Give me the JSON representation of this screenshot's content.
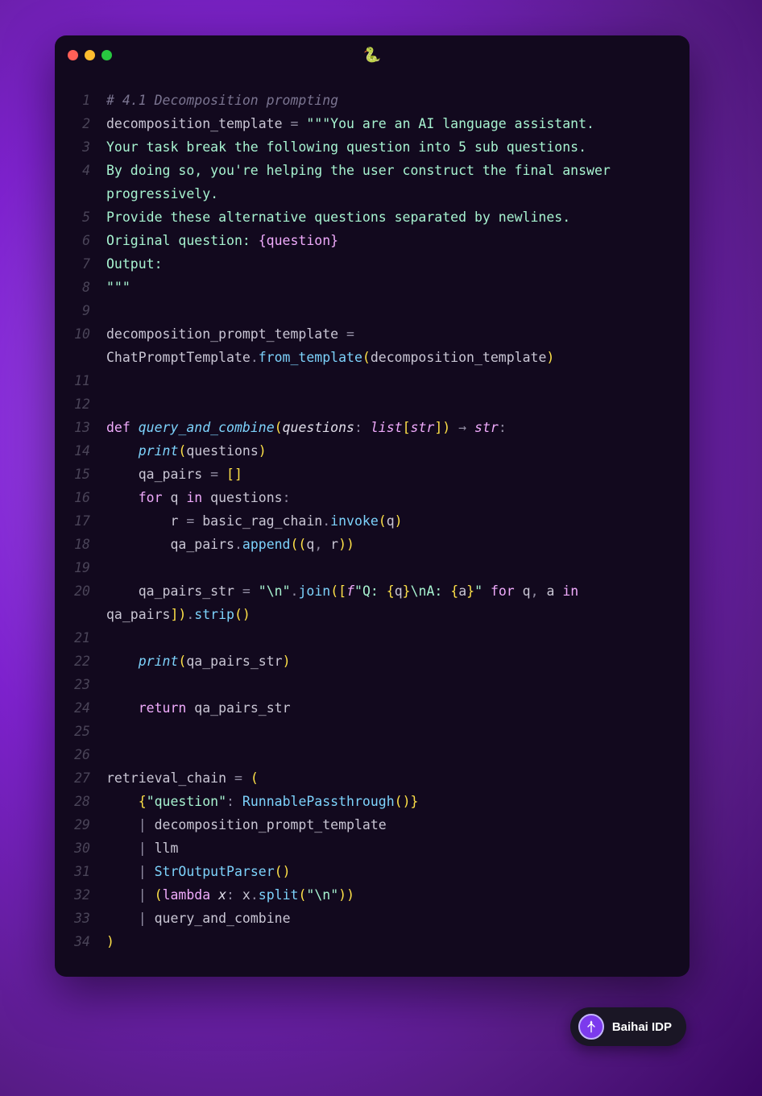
{
  "lang_icon": "🐍",
  "badge": {
    "text": "Baihai IDP"
  },
  "code": {
    "lines": [
      {
        "n": 1,
        "segs": [
          {
            "t": "# 4.1 Decomposition prompting",
            "c": "c-comment"
          }
        ]
      },
      {
        "n": 2,
        "segs": [
          {
            "t": "decomposition_template ",
            "c": "c-default"
          },
          {
            "t": "=",
            "c": "c-op"
          },
          {
            "t": " ",
            "c": "c-default"
          },
          {
            "t": "\"\"\"You are an AI language assistant.",
            "c": "c-str"
          }
        ]
      },
      {
        "n": 3,
        "segs": [
          {
            "t": "Your task break the following question into 5 sub questions.",
            "c": "c-str"
          }
        ]
      },
      {
        "n": 4,
        "segs": [
          {
            "t": "By doing so, you're helping the user construct the final answer ",
            "c": "c-str"
          }
        ]
      },
      {
        "n": "",
        "segs": [
          {
            "t": "progressively.",
            "c": "c-str"
          }
        ]
      },
      {
        "n": 5,
        "segs": [
          {
            "t": "Provide these alternative questions separated by newlines.",
            "c": "c-str"
          }
        ]
      },
      {
        "n": 6,
        "segs": [
          {
            "t": "Original question: ",
            "c": "c-str"
          },
          {
            "t": "{question}",
            "c": "c-placeholder"
          }
        ]
      },
      {
        "n": 7,
        "segs": [
          {
            "t": "Output:",
            "c": "c-str"
          }
        ]
      },
      {
        "n": 8,
        "segs": [
          {
            "t": "\"\"\"",
            "c": "c-str"
          }
        ]
      },
      {
        "n": 9,
        "segs": [
          {
            "t": "",
            "c": "c-default"
          }
        ]
      },
      {
        "n": 10,
        "segs": [
          {
            "t": "decomposition_prompt_template ",
            "c": "c-default"
          },
          {
            "t": "=",
            "c": "c-op"
          },
          {
            "t": " ",
            "c": "c-default"
          }
        ]
      },
      {
        "n": "",
        "segs": [
          {
            "t": "ChatPromptTemplate",
            "c": "c-default"
          },
          {
            "t": ".",
            "c": "c-op"
          },
          {
            "t": "from_template",
            "c": "c-fn"
          },
          {
            "t": "(",
            "c": "c-brace"
          },
          {
            "t": "decomposition_template",
            "c": "c-default"
          },
          {
            "t": ")",
            "c": "c-brace"
          }
        ]
      },
      {
        "n": 11,
        "segs": [
          {
            "t": "",
            "c": "c-default"
          }
        ]
      },
      {
        "n": 12,
        "segs": [
          {
            "t": "",
            "c": "c-default"
          }
        ]
      },
      {
        "n": 13,
        "segs": [
          {
            "t": "def ",
            "c": "c-kw"
          },
          {
            "t": "query_and_combine",
            "c": "c-fn-i"
          },
          {
            "t": "(",
            "c": "c-brace"
          },
          {
            "t": "questions",
            "c": "c-param"
          },
          {
            "t": ":",
            "c": "c-op"
          },
          {
            "t": " list",
            "c": "c-type"
          },
          {
            "t": "[",
            "c": "c-brace"
          },
          {
            "t": "str",
            "c": "c-type"
          },
          {
            "t": "]",
            "c": "c-brace"
          },
          {
            "t": ")",
            "c": "c-brace"
          },
          {
            "t": " → ",
            "c": "c-op"
          },
          {
            "t": "str",
            "c": "c-type"
          },
          {
            "t": ":",
            "c": "c-op"
          }
        ]
      },
      {
        "n": 14,
        "segs": [
          {
            "t": "    ",
            "c": "c-default"
          },
          {
            "t": "print",
            "c": "c-fn-i"
          },
          {
            "t": "(",
            "c": "c-brace"
          },
          {
            "t": "questions",
            "c": "c-default"
          },
          {
            "t": ")",
            "c": "c-brace"
          }
        ]
      },
      {
        "n": 15,
        "segs": [
          {
            "t": "    qa_pairs ",
            "c": "c-default"
          },
          {
            "t": "=",
            "c": "c-op"
          },
          {
            "t": " ",
            "c": "c-default"
          },
          {
            "t": "[]",
            "c": "c-brace"
          }
        ]
      },
      {
        "n": 16,
        "segs": [
          {
            "t": "    ",
            "c": "c-default"
          },
          {
            "t": "for",
            "c": "c-kw"
          },
          {
            "t": " q ",
            "c": "c-default"
          },
          {
            "t": "in",
            "c": "c-kw"
          },
          {
            "t": " questions",
            "c": "c-default"
          },
          {
            "t": ":",
            "c": "c-op"
          }
        ]
      },
      {
        "n": 17,
        "segs": [
          {
            "t": "        r ",
            "c": "c-default"
          },
          {
            "t": "=",
            "c": "c-op"
          },
          {
            "t": " basic_rag_chain",
            "c": "c-default"
          },
          {
            "t": ".",
            "c": "c-op"
          },
          {
            "t": "invoke",
            "c": "c-fn"
          },
          {
            "t": "(",
            "c": "c-brace"
          },
          {
            "t": "q",
            "c": "c-default"
          },
          {
            "t": ")",
            "c": "c-brace"
          }
        ]
      },
      {
        "n": 18,
        "segs": [
          {
            "t": "        qa_pairs",
            "c": "c-default"
          },
          {
            "t": ".",
            "c": "c-op"
          },
          {
            "t": "append",
            "c": "c-fn"
          },
          {
            "t": "((",
            "c": "c-brace"
          },
          {
            "t": "q",
            "c": "c-default"
          },
          {
            "t": ",",
            "c": "c-op"
          },
          {
            "t": " r",
            "c": "c-default"
          },
          {
            "t": "))",
            "c": "c-brace"
          }
        ]
      },
      {
        "n": 19,
        "segs": [
          {
            "t": "",
            "c": "c-default"
          }
        ]
      },
      {
        "n": 20,
        "segs": [
          {
            "t": "    qa_pairs_str ",
            "c": "c-default"
          },
          {
            "t": "=",
            "c": "c-op"
          },
          {
            "t": " ",
            "c": "c-default"
          },
          {
            "t": "\"\\n\"",
            "c": "c-str"
          },
          {
            "t": ".",
            "c": "c-op"
          },
          {
            "t": "join",
            "c": "c-fn"
          },
          {
            "t": "([",
            "c": "c-brace"
          },
          {
            "t": "f",
            "c": "c-fstr-prefix"
          },
          {
            "t": "\"Q: ",
            "c": "c-str"
          },
          {
            "t": "{",
            "c": "c-brace"
          },
          {
            "t": "q",
            "c": "c-default"
          },
          {
            "t": "}",
            "c": "c-brace"
          },
          {
            "t": "\\nA: ",
            "c": "c-str"
          },
          {
            "t": "{",
            "c": "c-brace"
          },
          {
            "t": "a",
            "c": "c-default"
          },
          {
            "t": "}",
            "c": "c-brace"
          },
          {
            "t": "\"",
            "c": "c-str"
          },
          {
            "t": " ",
            "c": "c-default"
          },
          {
            "t": "for",
            "c": "c-kw"
          },
          {
            "t": " q",
            "c": "c-default"
          },
          {
            "t": ",",
            "c": "c-op"
          },
          {
            "t": " a ",
            "c": "c-default"
          },
          {
            "t": "in",
            "c": "c-kw"
          },
          {
            "t": " ",
            "c": "c-default"
          }
        ]
      },
      {
        "n": "",
        "segs": [
          {
            "t": "qa_pairs",
            "c": "c-default"
          },
          {
            "t": "])",
            "c": "c-brace"
          },
          {
            "t": ".",
            "c": "c-op"
          },
          {
            "t": "strip",
            "c": "c-fn"
          },
          {
            "t": "()",
            "c": "c-brace"
          }
        ]
      },
      {
        "n": 21,
        "segs": [
          {
            "t": "",
            "c": "c-default"
          }
        ]
      },
      {
        "n": 22,
        "segs": [
          {
            "t": "    ",
            "c": "c-default"
          },
          {
            "t": "print",
            "c": "c-fn-i"
          },
          {
            "t": "(",
            "c": "c-brace"
          },
          {
            "t": "qa_pairs_str",
            "c": "c-default"
          },
          {
            "t": ")",
            "c": "c-brace"
          }
        ]
      },
      {
        "n": 23,
        "segs": [
          {
            "t": "",
            "c": "c-default"
          }
        ]
      },
      {
        "n": 24,
        "segs": [
          {
            "t": "    ",
            "c": "c-default"
          },
          {
            "t": "return",
            "c": "c-kw"
          },
          {
            "t": " qa_pairs_str",
            "c": "c-default"
          }
        ]
      },
      {
        "n": 25,
        "segs": [
          {
            "t": "",
            "c": "c-default"
          }
        ]
      },
      {
        "n": 26,
        "segs": [
          {
            "t": "",
            "c": "c-default"
          }
        ]
      },
      {
        "n": 27,
        "segs": [
          {
            "t": "retrieval_chain ",
            "c": "c-default"
          },
          {
            "t": "=",
            "c": "c-op"
          },
          {
            "t": " ",
            "c": "c-default"
          },
          {
            "t": "(",
            "c": "c-brace"
          }
        ]
      },
      {
        "n": 28,
        "segs": [
          {
            "t": "    ",
            "c": "c-default"
          },
          {
            "t": "{",
            "c": "c-brace"
          },
          {
            "t": "\"question\"",
            "c": "c-str"
          },
          {
            "t": ":",
            "c": "c-op"
          },
          {
            "t": " ",
            "c": "c-default"
          },
          {
            "t": "RunnablePassthrough",
            "c": "c-fn"
          },
          {
            "t": "()",
            "c": "c-brace"
          },
          {
            "t": "}",
            "c": "c-brace"
          }
        ]
      },
      {
        "n": 29,
        "segs": [
          {
            "t": "    ",
            "c": "c-default"
          },
          {
            "t": "|",
            "c": "c-op"
          },
          {
            "t": " decomposition_prompt_template",
            "c": "c-default"
          }
        ]
      },
      {
        "n": 30,
        "segs": [
          {
            "t": "    ",
            "c": "c-default"
          },
          {
            "t": "|",
            "c": "c-op"
          },
          {
            "t": " llm",
            "c": "c-default"
          }
        ]
      },
      {
        "n": 31,
        "segs": [
          {
            "t": "    ",
            "c": "c-default"
          },
          {
            "t": "|",
            "c": "c-op"
          },
          {
            "t": " ",
            "c": "c-default"
          },
          {
            "t": "StrOutputParser",
            "c": "c-fn"
          },
          {
            "t": "()",
            "c": "c-brace"
          }
        ]
      },
      {
        "n": 32,
        "segs": [
          {
            "t": "    ",
            "c": "c-default"
          },
          {
            "t": "|",
            "c": "c-op"
          },
          {
            "t": " ",
            "c": "c-default"
          },
          {
            "t": "(",
            "c": "c-brace"
          },
          {
            "t": "lambda ",
            "c": "c-kw"
          },
          {
            "t": "x",
            "c": "c-param"
          },
          {
            "t": ":",
            "c": "c-op"
          },
          {
            "t": " x",
            "c": "c-default"
          },
          {
            "t": ".",
            "c": "c-op"
          },
          {
            "t": "split",
            "c": "c-fn"
          },
          {
            "t": "(",
            "c": "c-brace"
          },
          {
            "t": "\"\\n\"",
            "c": "c-str"
          },
          {
            "t": "))",
            "c": "c-brace"
          }
        ]
      },
      {
        "n": 33,
        "segs": [
          {
            "t": "    ",
            "c": "c-default"
          },
          {
            "t": "|",
            "c": "c-op"
          },
          {
            "t": " query_and_combine",
            "c": "c-default"
          }
        ]
      },
      {
        "n": 34,
        "segs": [
          {
            "t": ")",
            "c": "c-brace"
          }
        ]
      }
    ]
  }
}
